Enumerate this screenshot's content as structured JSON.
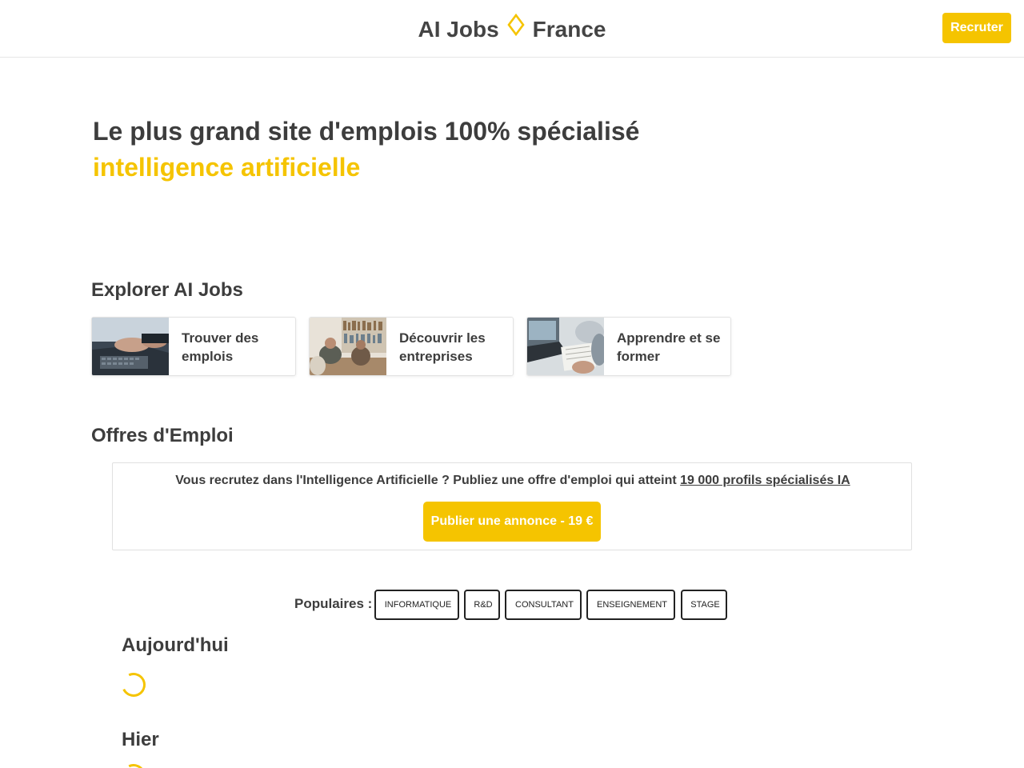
{
  "header": {
    "brand_left": "AI Jobs",
    "brand_right": "France",
    "recruit_label": "Recruter"
  },
  "hero": {
    "line1": "Le plus grand site d'emplois 100% spécialisé",
    "line2": "intelligence artificielle"
  },
  "explore": {
    "title": "Explorer AI Jobs",
    "cards": [
      {
        "label": "Trouver des emplois"
      },
      {
        "label": "Découvrir les entreprises"
      },
      {
        "label": "Apprendre et se former"
      }
    ]
  },
  "offers": {
    "title": "Offres d'Emploi",
    "promo_icon": "",
    "promo_text": "Vous recrutez dans l'Intelligence Artificielle ? Publiez une offre d'emploi qui atteint",
    "promo_link": "19 000 profils spécialisés IA",
    "publish_label": "Publier une annonce - 19 €"
  },
  "popular": {
    "label": "Populaires :",
    "tags": [
      {
        "icon": "",
        "label": "INFORMATIQUE"
      },
      {
        "icon": "",
        "label": "R&D"
      },
      {
        "icon": "",
        "label": "CONSULTANT"
      },
      {
        "icon": "",
        "label": "ENSEIGNEMENT"
      },
      {
        "icon": "",
        "label": "STAGE"
      }
    ]
  },
  "days": {
    "today": "Aujourd'hui",
    "yesterday": "Hier"
  },
  "colors": {
    "accent": "#f5c400",
    "text": "#3d3d3d"
  }
}
